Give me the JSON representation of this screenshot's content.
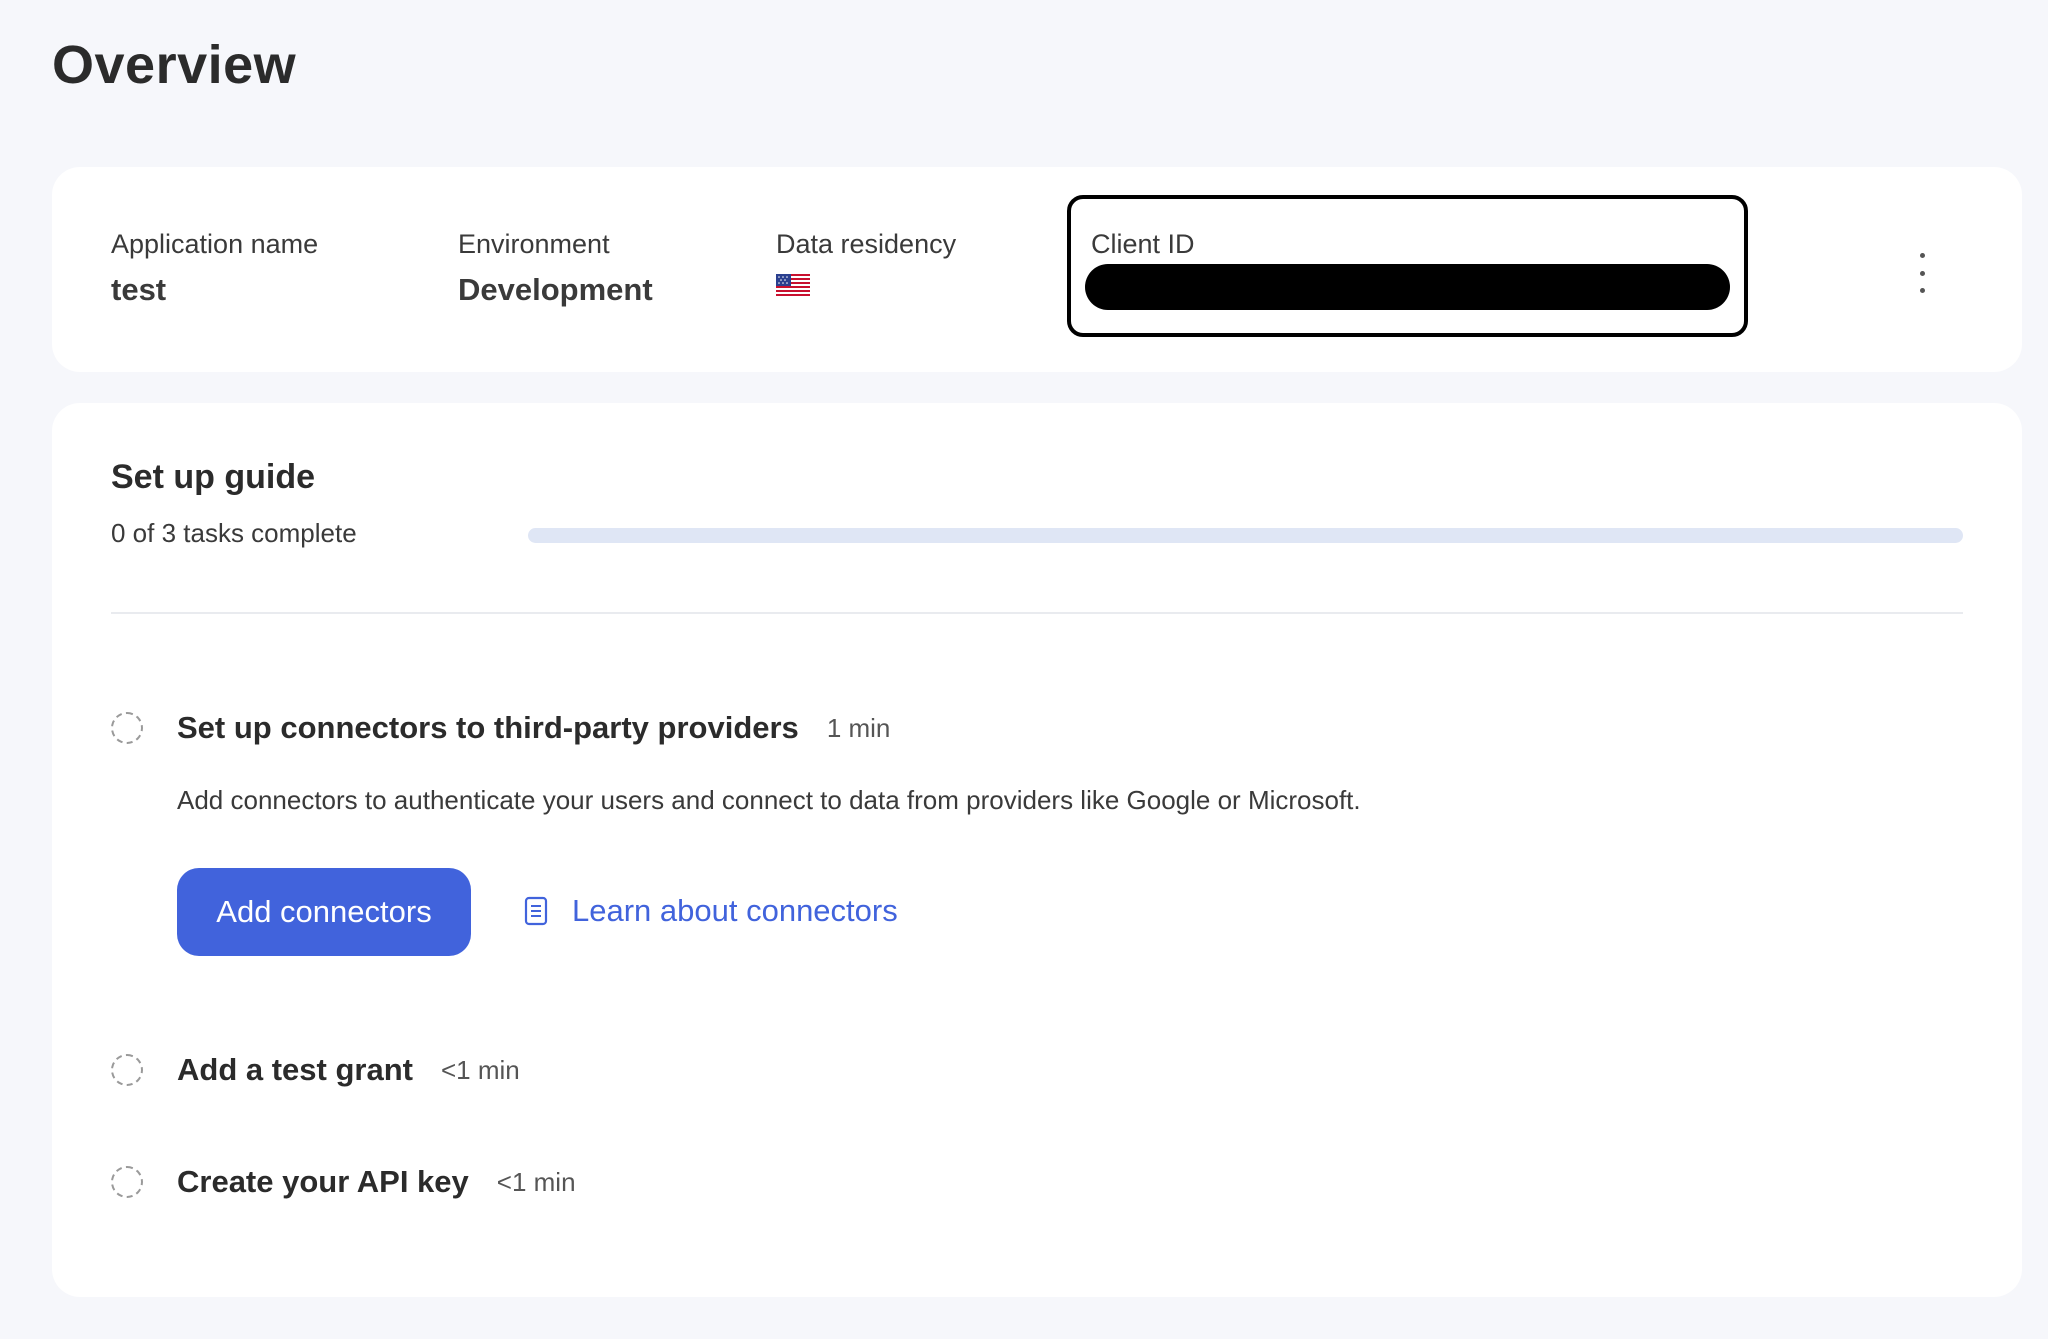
{
  "page": {
    "title": "Overview"
  },
  "app_info": {
    "application_name_label": "Application name",
    "application_name_value": "test",
    "environment_label": "Environment",
    "environment_value": "Development",
    "data_residency_label": "Data residency",
    "data_residency_icon": "us-flag-icon",
    "client_id_label": "Client ID",
    "client_id_redacted": true,
    "menu_icon": "kebab-menu-icon"
  },
  "guide": {
    "title": "Set up guide",
    "progress_text": "0 of 3 tasks complete",
    "progress_fraction": 0,
    "tasks": [
      {
        "title": "Set up connectors to third-party providers",
        "time": "1 min",
        "description": "Add connectors to authenticate your users and connect to data from providers like Google or Microsoft.",
        "primary_button": "Add connectors",
        "link_text": "Learn about connectors",
        "link_icon": "document-icon",
        "status_icon": "dashed-circle-icon"
      },
      {
        "title": "Add a test grant",
        "time": "<1 min",
        "status_icon": "dashed-circle-icon"
      },
      {
        "title": "Create your API key",
        "time": "<1 min",
        "status_icon": "dashed-circle-icon"
      }
    ]
  },
  "colors": {
    "accent": "#4163dc",
    "progress_track": "#dfe6f5",
    "background": "#f6f7fb"
  }
}
